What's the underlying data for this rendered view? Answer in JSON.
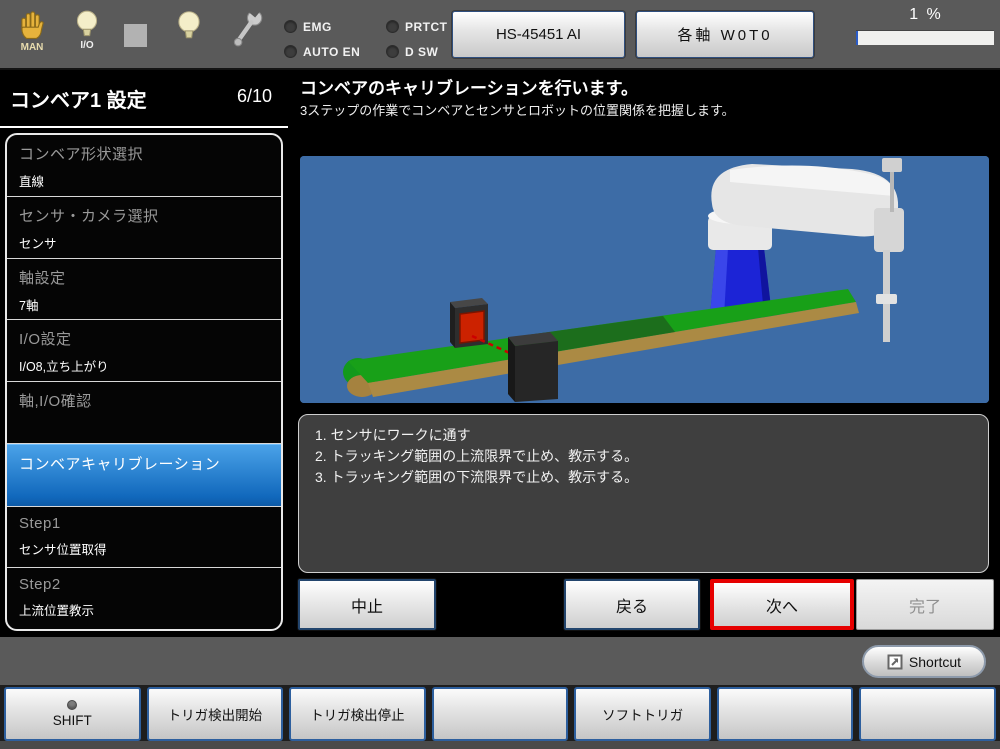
{
  "top_bar": {
    "icons": {
      "hand_label": "MAN",
      "io_label": "I/O"
    },
    "leds": [
      "EMG",
      "AUTO EN",
      "PRTCT",
      "D SW"
    ],
    "robot_name": "HS-45451 AI",
    "mode": "各軸 W0T0",
    "speed_label": "1 %"
  },
  "sidebar": {
    "title": "コンベア1 設定",
    "page": "6/10",
    "items": [
      {
        "label": "コンベア形状選択",
        "value": "直線"
      },
      {
        "label": "センサ・カメラ選択",
        "value": "センサ"
      },
      {
        "label": "軸設定",
        "value": "7軸"
      },
      {
        "label": "I/O設定",
        "value": "I/O8,立ち上がり"
      },
      {
        "label": "軸,I/O確認",
        "value": ""
      },
      {
        "label": "コンベアキャリブレーション",
        "value": ""
      },
      {
        "label": "Step1",
        "value": "センサ位置取得"
      },
      {
        "label": "Step2",
        "value": "上流位置教示"
      }
    ]
  },
  "main": {
    "title": "コンベアのキャリブレーションを行います。",
    "subtitle": "3ステップの作業でコンベアとセンサとロボットの位置関係を把握します。",
    "instructions": [
      "1. センサにワークに通す",
      "2. トラッキング範囲の上流限界で止め、教示する。",
      "3. トラッキング範囲の下流限界で止め、教示する。"
    ],
    "buttons": {
      "abort": "中止",
      "back": "戻る",
      "next": "次へ",
      "finish": "完了"
    }
  },
  "shortcut_label": "Shortcut",
  "function_keys": [
    "SHIFT",
    "トリガ検出開始",
    "トリガ検出停止",
    "",
    "ソフトトリガ",
    "",
    ""
  ],
  "colors": {
    "selected_item_blue": "#1168bc",
    "highlight_red": "#e60000",
    "scene_background": "#3d6ca6",
    "topbar_gray": "#5a5a5a"
  }
}
